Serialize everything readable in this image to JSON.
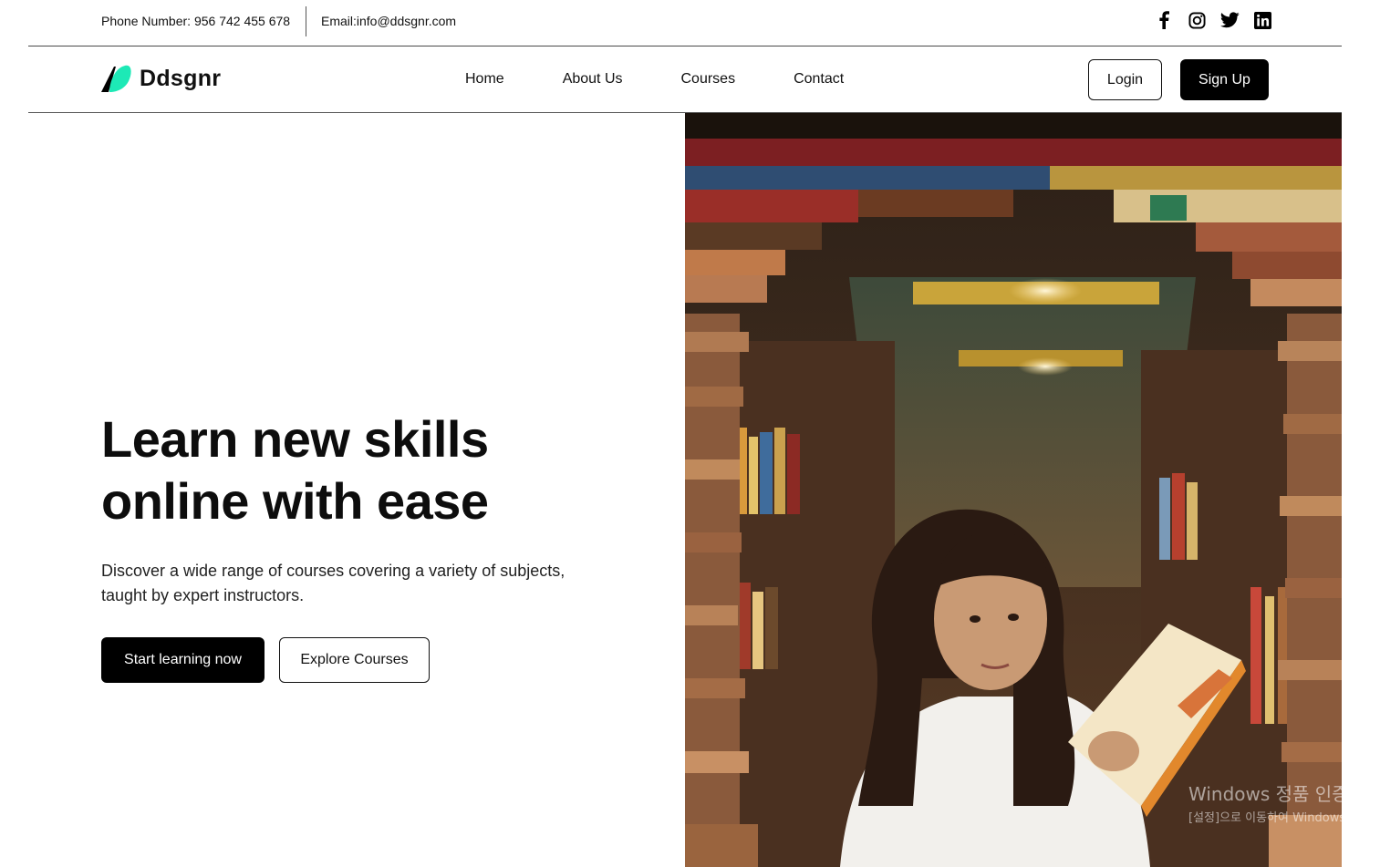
{
  "topbar": {
    "phone": "Phone Number: 956 742 455 678",
    "email": "Email:info@ddsgnr.com",
    "socials": [
      "facebook-icon",
      "instagram-icon",
      "twitter-icon",
      "linkedin-icon"
    ]
  },
  "nav": {
    "brand": "Ddsgnr",
    "logo_colors": [
      "#000000",
      "#1de9b6"
    ],
    "links": [
      "Home",
      "About Us",
      "Courses",
      "Contact"
    ],
    "login": "Login",
    "signup": "Sign Up"
  },
  "hero": {
    "title_line1": "Learn new skills",
    "title_line2": "online with ease",
    "description": "Discover a wide range of courses covering a variety of subjects, taught by expert instructors.",
    "primary_button": "Start learning now",
    "secondary_button": "Explore Courses"
  },
  "watermark": {
    "line1": "Windows 정품 인증",
    "line2": "[설정]으로 이동하여 Windows를"
  }
}
